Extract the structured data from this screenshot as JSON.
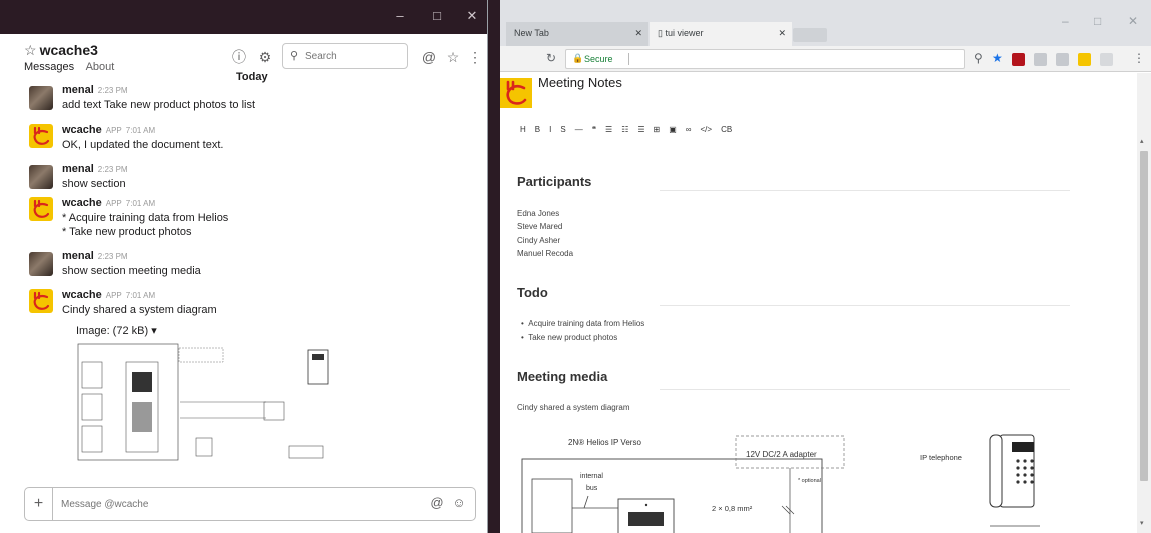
{
  "slack": {
    "channel_name": "wcache3",
    "tabs": [
      "Messages",
      "About"
    ],
    "search_placeholder": "Search",
    "day_divider": "Today",
    "messages": [
      {
        "author": "menal",
        "app": "",
        "time": "2:23 PM",
        "lines": [
          "add text Take new product photos to list"
        ],
        "avatar": "photo"
      },
      {
        "author": "wcache",
        "app": "APP",
        "time": "7:01 AM",
        "lines": [
          "OK, I updated the document text."
        ],
        "avatar": "bot"
      },
      {
        "author": "menal",
        "app": "",
        "time": "2:23 PM",
        "lines": [
          "show section"
        ],
        "avatar": "photo"
      },
      {
        "author": "wcache",
        "app": "APP",
        "time": "7:01 AM",
        "lines": [
          "* Acquire training data from Helios",
          "* Take new product photos"
        ],
        "avatar": "bot"
      },
      {
        "author": "menal",
        "app": "",
        "time": "2:23 PM",
        "lines": [
          "show section meeting media"
        ],
        "avatar": "photo"
      },
      {
        "author": "wcache",
        "app": "APP",
        "time": "7:01 AM",
        "lines": [
          "Cindy shared a system diagram"
        ],
        "avatar": "bot"
      }
    ],
    "image_label": "Image: (72 kB) ▾",
    "composer_placeholder": "Message @wcache"
  },
  "chrome": {
    "tabs": [
      {
        "title": "New Tab",
        "active": false
      },
      {
        "title": "tui viewer",
        "active": true
      }
    ],
    "url_security": "Secure",
    "page_title": "Meeting Notes",
    "toolbar_items": [
      "H",
      "B",
      "I",
      "S",
      "—",
      "❝",
      "☰",
      "☷",
      "☰",
      "⊞",
      "▣",
      "∞",
      "</>",
      "CB"
    ],
    "sections": {
      "participants": {
        "heading": "Participants",
        "names": [
          "Edna Jones",
          "Steve Mared",
          "Cindy Asher",
          "Manuel Recoda"
        ]
      },
      "todo": {
        "heading": "Todo",
        "items": [
          "Acquire training data from Helios",
          "Take new product photos"
        ]
      },
      "media": {
        "heading": "Meeting media",
        "text": "Cindy shared a system diagram"
      }
    },
    "diagram": {
      "title": "2N® Helios IP Verso",
      "adapter": "12V DC/2 A adapter",
      "optional": "* optional",
      "bus": "internal\nbus",
      "wire": "2 × 0,8 mm²",
      "phone": "IP telephone"
    }
  },
  "colors": {
    "slack_titlebar": "#2b1b24",
    "bot_yellow": "#f5c400",
    "logo_red": "#d9261c"
  }
}
